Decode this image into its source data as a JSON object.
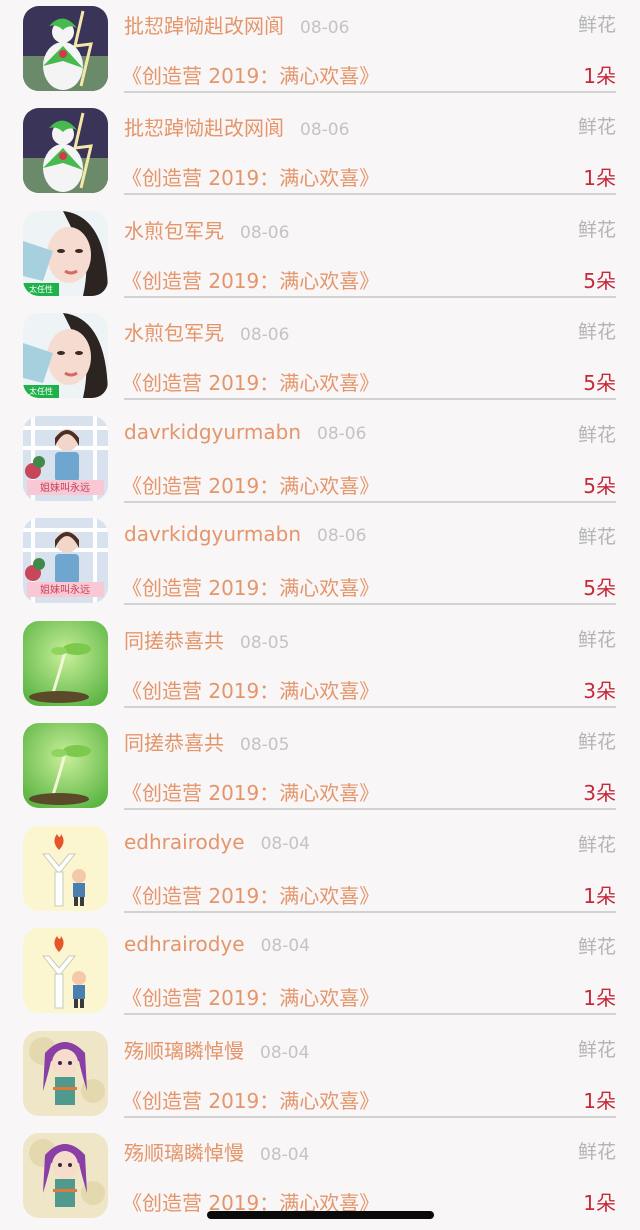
{
  "gift_records": [
    {
      "avatar": "green-creature-avatar",
      "name": "批恝踔恸赳改网阆",
      "date": "08-06",
      "gift_type": "鲜花",
      "program": "《创造营 2019：满心欢喜》",
      "count": "1朵"
    },
    {
      "avatar": "green-creature-avatar",
      "name": "批恝踔恸赳改网阆",
      "date": "08-06",
      "gift_type": "鲜花",
      "program": "《创造营 2019：满心欢喜》",
      "count": "1朵"
    },
    {
      "avatar": "girl-selfie-avatar",
      "name": "水煎包军旯",
      "date": "08-06",
      "gift_type": "鲜花",
      "program": "《创造营 2019：满心欢喜》",
      "count": "5朵",
      "avatar_caption": "太任性"
    },
    {
      "avatar": "girl-selfie-avatar",
      "name": "水煎包军旯",
      "date": "08-06",
      "gift_type": "鲜花",
      "program": "《创造营 2019：满心欢喜》",
      "count": "5朵",
      "avatar_caption": "太任性"
    },
    {
      "avatar": "girl-fence-avatar",
      "name": "davrkidgyurmabn",
      "date": "08-06",
      "gift_type": "鲜花",
      "program": "《创造营 2019：满心欢喜》",
      "count": "5朵",
      "avatar_caption": "姐妹叫永远"
    },
    {
      "avatar": "girl-fence-avatar",
      "name": "davrkidgyurmabn",
      "date": "08-06",
      "gift_type": "鲜花",
      "program": "《创造营 2019：满心欢喜》",
      "count": "5朵",
      "avatar_caption": "姐妹叫永远"
    },
    {
      "avatar": "sprout-avatar",
      "name": "同搓恭喜共",
      "date": "08-05",
      "gift_type": "鲜花",
      "program": "《创造营 2019：满心欢喜》",
      "count": "3朵"
    },
    {
      "avatar": "sprout-avatar",
      "name": "同搓恭喜共",
      "date": "08-05",
      "gift_type": "鲜花",
      "program": "《创造营 2019：满心欢喜》",
      "count": "3朵"
    },
    {
      "avatar": "torch-boy-avatar",
      "name": "edhrairodye",
      "date": "08-04",
      "gift_type": "鲜花",
      "program": "《创造营 2019：满心欢喜》",
      "count": "1朵"
    },
    {
      "avatar": "torch-boy-avatar",
      "name": "edhrairodye",
      "date": "08-04",
      "gift_type": "鲜花",
      "program": "《创造营 2019：满心欢喜》",
      "count": "1朵"
    },
    {
      "avatar": "purple-hair-girl-avatar",
      "name": "殇顺璃瞵悼慢",
      "date": "08-04",
      "gift_type": "鲜花",
      "program": "《创造营 2019：满心欢喜》",
      "count": "1朵"
    },
    {
      "avatar": "purple-hair-girl-avatar",
      "name": "殇顺璃瞵悼慢",
      "date": "08-04",
      "gift_type": "鲜花",
      "program": "《创造营 2019：满心欢喜》",
      "count": "1朵"
    }
  ],
  "colors": {
    "background": "#f8f6f7",
    "name_text": "#e4956a",
    "count_text": "#c52a3a",
    "muted_text": "#b4b4b4",
    "divider": "#d2d2d2"
  }
}
